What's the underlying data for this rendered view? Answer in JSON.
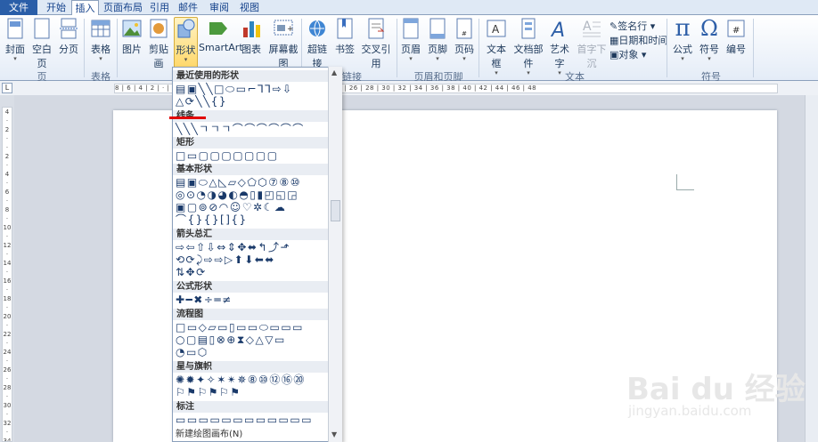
{
  "tabs": [
    "文件",
    "开始",
    "插入",
    "页面布局",
    "引用",
    "邮件",
    "审阅",
    "视图"
  ],
  "ribbon": {
    "pages": {
      "cover": "封面",
      "blank": "空白页",
      "break": "分页",
      "group": "页"
    },
    "tables": {
      "table": "表格",
      "group": "表格"
    },
    "illustrations": {
      "picture": "图片",
      "clipart": "剪贴画",
      "shapes": "形状",
      "smartart": "SmartArt",
      "chart": "图表",
      "screenshot": "屏幕截图"
    },
    "links": {
      "hyperlink": "超链接",
      "bookmark": "书签",
      "crossref": "交叉引用",
      "group": "链接"
    },
    "headerfooter": {
      "header": "页眉",
      "footer": "页脚",
      "pagenum": "页码",
      "group": "页眉和页脚"
    },
    "text": {
      "textbox": "文本框",
      "quickparts": "文档部件",
      "wordart": "艺术字",
      "dropcap": "首字下沉",
      "signature": "签名行",
      "datetime": "日期和时间",
      "object": "对象",
      "group": "文本"
    },
    "symbols": {
      "equation": "公式",
      "symbol": "符号",
      "number": "编号",
      "group": "符号"
    }
  },
  "ruler": {
    "h": "8 | 6 | 4 | 2 | · | 2 | 4 | 6 | 8 | 10 | 12 | 14 | 16 | 18 | 20 | 22 | 24 | 26 | 28 | 30 | 32 | 34 | 36 | 38 | 40 | 42 | 44 | 46 | 48",
    "corner": "L"
  },
  "gallery": {
    "recent": "最近使用的形状",
    "lines": "线条",
    "rect": "矩形",
    "basic": "基本形状",
    "arrows": "箭头总汇",
    "equation": "公式形状",
    "flowchart": "流程图",
    "stars": "星与旗帜",
    "callouts": "标注",
    "new_canvas": "新建绘图画布(N)",
    "rows": {
      "recent1": "▤▣╲╲□⬭▭⌐⅂⅂⇨⇩",
      "recent2": "△⟳╲╲{}",
      "lines1": "╲╲╲ㄱㄱㄱ⌒⌒⌒⌒⌒⌒",
      "rect1": "□▭▢▢▢▢▢▢▢",
      "basic1": "▤▣⬭△◺▱◇⬠⬡⑦⑧⑩",
      "basic2": "◎⊙◔◑◕◐◓▯▮◰◱◲",
      "basic3": "▣▢⊚⊘◠☺♡✲☾☁",
      "basic4": "⌒{}{}[]{}",
      "arrows1": "⇨⇦⇧⇩⇔⇕✥⬌↰⤴⬏",
      "arrows2": "⟲⟳⤸⇨⇨▷⬆⬇⬅⬌",
      "arrows3": "⇅✥⟳",
      "eq1": "✚━✖÷═≠",
      "flow1": "□▭◇▱▭▯▭▭⬭▭▭▭",
      "flow2": "○▢▤▯⊗⊕⧗◇△▽▭",
      "flow3": "◔▭⬡",
      "stars1": "✺✹✦✧✶✴✵⑧⑩⑫⑯⑳",
      "stars2": "⚐⚑⚐⚑⚐⚑",
      "callouts1": "▭▭▭▭▭▭▭▭▭▭▭▭"
    }
  },
  "watermark": {
    "main": "Bai du 经验",
    "sub": "jingyan.baidu.com"
  }
}
